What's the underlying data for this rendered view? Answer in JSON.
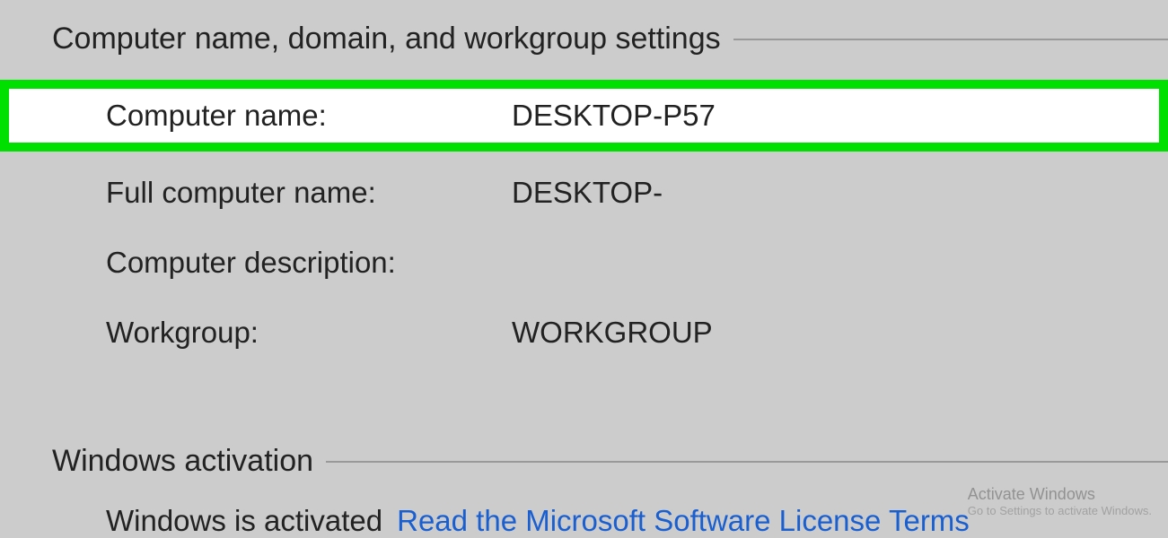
{
  "sections": {
    "computer": {
      "header": "Computer name, domain, and workgroup settings",
      "rows": {
        "computer_name": {
          "label": "Computer name:",
          "value": "DESKTOP-P57"
        },
        "full_computer_name": {
          "label": "Full computer name:",
          "value": "DESKTOP-"
        },
        "computer_description": {
          "label": "Computer description:",
          "value": ""
        },
        "workgroup": {
          "label": "Workgroup:",
          "value": "WORKGROUP"
        }
      }
    },
    "activation": {
      "header": "Windows activation",
      "status": "Windows is activated",
      "link": "Read the Microsoft Software License Terms"
    }
  },
  "watermark": {
    "title": "Activate Windows",
    "subtitle": "Go to Settings to activate Windows."
  }
}
